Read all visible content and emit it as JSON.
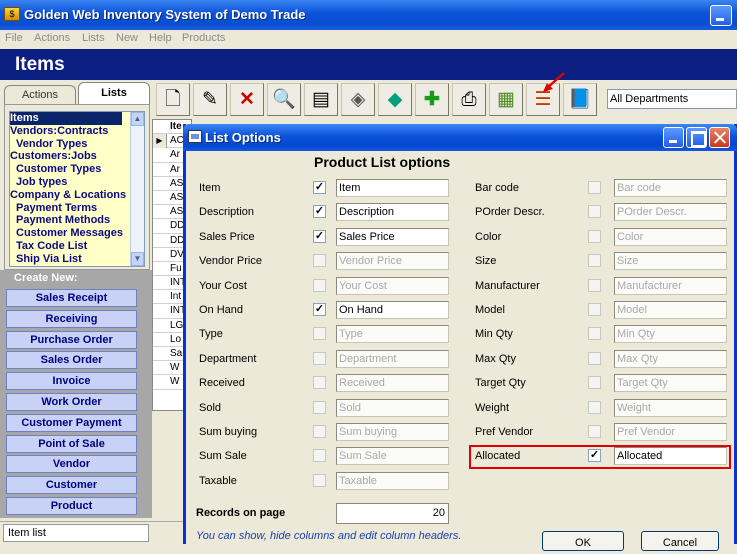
{
  "app": {
    "title": "Golden Web Inventory System of Demo Trade",
    "icon": "app-icon"
  },
  "menu": [
    "File",
    "Actions",
    "Lists",
    "New",
    "Help",
    "Products"
  ],
  "page_title": "Items",
  "tabs": {
    "actions": "Actions",
    "lists": "Lists"
  },
  "lists": [
    {
      "label": "Items",
      "selected": true
    },
    {
      "label": "Vendors:Contracts"
    },
    {
      "label": "Vendor Types",
      "indent": true
    },
    {
      "label": "Customers:Jobs"
    },
    {
      "label": "Customer Types",
      "indent": true
    },
    {
      "label": "Job types",
      "indent": true
    },
    {
      "label": "Company & Locations"
    },
    {
      "label": "Payment Terms",
      "indent": true
    },
    {
      "label": "Payment Methods",
      "indent": true
    },
    {
      "label": "Customer Messages",
      "indent": true
    },
    {
      "label": "Tax Code List",
      "indent": true
    },
    {
      "label": "Ship Via List",
      "indent": true
    }
  ],
  "create_new": {
    "label": "Create New:",
    "buttons": [
      "Sales Receipt",
      "Receiving",
      "Purchase Order",
      "Sales Order",
      "Invoice",
      "Work Order",
      "Customer Payment",
      "Point of Sale",
      "Vendor",
      "Customer",
      "Product"
    ]
  },
  "toolbar": {
    "icons": [
      "new-document-icon",
      "edit-icon",
      "delete-icon",
      "search-icon",
      "scanner-icon",
      "gem-icon",
      "diamond-icon",
      "add-icon",
      "print-icon",
      "calculator-icon",
      "list-options-icon",
      "book-icon"
    ],
    "department": "All Departments"
  },
  "grid": {
    "header": "Ite",
    "rows": [
      "AC",
      "Ar",
      "Ar",
      "AS",
      "AS",
      "AS",
      "DD",
      "DD",
      "DV",
      "Fu",
      "INT",
      "Int",
      "INT",
      "LG",
      "Lo",
      "Sa",
      "W",
      "W"
    ]
  },
  "status": "Item list",
  "dialog": {
    "title": "List Options",
    "heading": "Product List options",
    "left": [
      {
        "label": "Item",
        "checked": true,
        "value": "Item"
      },
      {
        "label": "Description",
        "checked": true,
        "value": "Description"
      },
      {
        "label": "Sales Price",
        "checked": true,
        "value": "Sales Price"
      },
      {
        "label": "Vendor Price",
        "checked": false,
        "value": "Vendor Price"
      },
      {
        "label": "Your Cost",
        "checked": false,
        "value": "Your Cost"
      },
      {
        "label": "On Hand",
        "checked": true,
        "value": "On Hand"
      },
      {
        "label": "Type",
        "checked": false,
        "value": "Type"
      },
      {
        "label": "Department",
        "checked": false,
        "value": "Department"
      },
      {
        "label": "Received",
        "checked": false,
        "value": "Received"
      },
      {
        "label": "Sold",
        "checked": false,
        "value": "Sold"
      },
      {
        "label": "Sum buying",
        "checked": false,
        "value": "Sum buying"
      },
      {
        "label": "Sum Sale",
        "checked": false,
        "value": "Sum Sale"
      },
      {
        "label": "Taxable",
        "checked": false,
        "value": "Taxable"
      }
    ],
    "right": [
      {
        "label": "Bar code",
        "checked": false,
        "value": "Bar code"
      },
      {
        "label": "POrder Descr.",
        "checked": false,
        "value": "POrder Descr."
      },
      {
        "label": "Color",
        "checked": false,
        "value": "Color"
      },
      {
        "label": "Size",
        "checked": false,
        "value": "Size"
      },
      {
        "label": "Manufacturer",
        "checked": false,
        "value": "Manufacturer"
      },
      {
        "label": "Model",
        "checked": false,
        "value": "Model"
      },
      {
        "label": "Min Qty",
        "checked": false,
        "value": "Min Qty"
      },
      {
        "label": "Max Qty",
        "checked": false,
        "value": "Max Qty"
      },
      {
        "label": "Target Qty",
        "checked": false,
        "value": "Target Qty"
      },
      {
        "label": "Weight",
        "checked": false,
        "value": "Weight"
      },
      {
        "label": "Pref Vendor",
        "checked": false,
        "value": "Pref Vendor"
      },
      {
        "label": "Allocated",
        "checked": true,
        "value": "Allocated"
      }
    ],
    "records_label": "Records on page",
    "records_value": "20",
    "hint": "You can show, hide columns and edit column headers.",
    "ok": "OK",
    "cancel": "Cancel"
  },
  "colors": {
    "header_bg": "#0b1f82",
    "create_btn_text": "#000080",
    "highlight": "#e00000"
  }
}
